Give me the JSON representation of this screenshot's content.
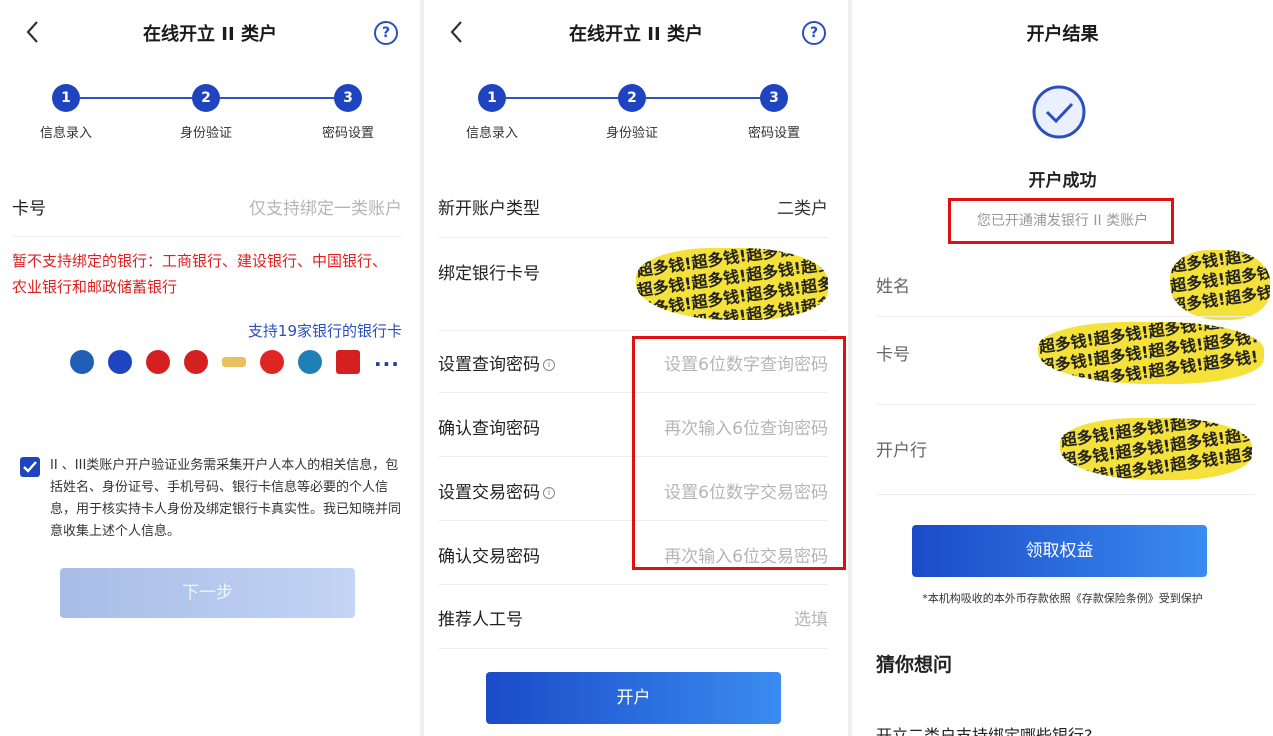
{
  "screen1": {
    "title": "在线开立 II 类户",
    "help": "?",
    "steps": [
      {
        "num": "1",
        "label": "信息录入"
      },
      {
        "num": "2",
        "label": "身份验证"
      },
      {
        "num": "3",
        "label": "密码设置"
      }
    ],
    "card_label": "卡号",
    "card_placeholder": "仅支持绑定一类账户",
    "unsupported_notice": "暂不支持绑定的银行：工商银行、建设银行、中国银行、农业银行和邮政储蓄银行",
    "supported_link": "支持19家银行的银行卡",
    "more": "···",
    "consent": "II 、III类账户开户验证业务需采集开户人本人的相关信息，包括姓名、身份证号、手机号码、银行卡信息等必要的个人信息，用于核实持卡人身份及绑定银行卡真实性。我已知晓并同意收集上述个人信息。",
    "next_button": "下一步",
    "colors": {
      "primary": "#1f44c0",
      "warning": "#e02020",
      "link": "#2a4fbe"
    }
  },
  "screen2": {
    "title": "在线开立 II 类户",
    "help": "?",
    "steps": [
      {
        "num": "1",
        "label": "信息录入"
      },
      {
        "num": "2",
        "label": "身份验证"
      },
      {
        "num": "3",
        "label": "密码设置"
      }
    ],
    "rows": [
      {
        "label": "新开账户类型",
        "value": "二类户"
      },
      {
        "label": "绑定银行卡号",
        "value": ""
      },
      {
        "label": "设置查询密码",
        "placeholder": "设置6位数字查询密码"
      },
      {
        "label": "确认查询密码",
        "placeholder": "再次输入6位查询密码"
      },
      {
        "label": "设置交易密码",
        "placeholder": "设置6位数字交易密码"
      },
      {
        "label": "确认交易密码",
        "placeholder": "再次输入6位交易密码"
      },
      {
        "label": "推荐人工号",
        "placeholder": "选填"
      }
    ],
    "info_mark": "i",
    "open_button": "开户"
  },
  "screen3": {
    "title": "开户结果",
    "success_title": "开户成功",
    "success_sub": "您已开通浦发银行 II 类账户",
    "rows": [
      {
        "label": "姓名"
      },
      {
        "label": "卡号"
      },
      {
        "label": "开户行"
      }
    ],
    "claim_button": "领取权益",
    "footnote": "*本机构吸收的本外币存款依照《存款保险条例》受到保护",
    "faq_title": "猜你想问",
    "faq_first": "开立二类户支持绑定哪些银行?"
  },
  "scribble_text": "超多钱!超多钱!超多钱!超多钱!"
}
